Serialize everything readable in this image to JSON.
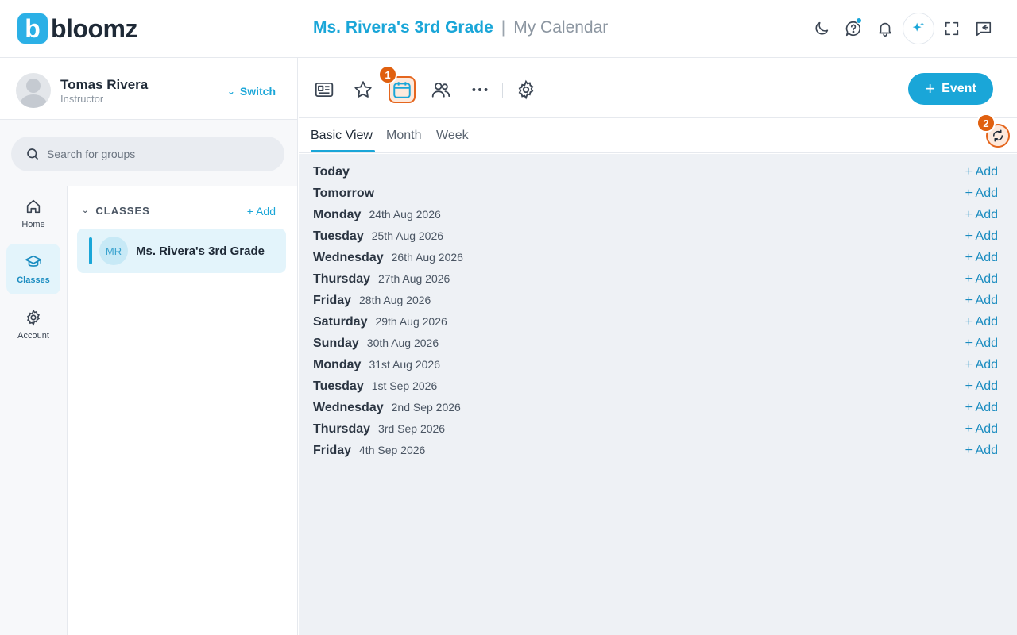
{
  "brand": {
    "name": "bloomz"
  },
  "header": {
    "group_name": "Ms. Rivera's 3rd Grade",
    "separator": "|",
    "page_name": "My Calendar",
    "icons": [
      "moon-icon",
      "help-icon",
      "bell-icon",
      "ai-sparkle-icon",
      "fullscreen-icon",
      "feedback-icon"
    ]
  },
  "profile": {
    "name": "Tomas Rivera",
    "role": "Instructor",
    "switch_label": "Switch"
  },
  "search": {
    "placeholder": "Search for groups"
  },
  "nav": {
    "items": [
      {
        "label": "Home",
        "icon": "home-icon",
        "active": false
      },
      {
        "label": "Classes",
        "icon": "graduation-cap-icon",
        "active": true
      },
      {
        "label": "Account",
        "icon": "gear-icon",
        "active": false
      }
    ]
  },
  "classes": {
    "heading": "CLASSES",
    "add_label": "Add",
    "items": [
      {
        "initials": "MR",
        "name": "Ms. Rivera's 3rd Grade"
      }
    ]
  },
  "toolbar": {
    "icons": [
      "newsletter-icon",
      "star-icon",
      "calendar-icon",
      "people-icon",
      "more-icon",
      "settings-icon"
    ],
    "badge_1": "1",
    "badge_2": "2",
    "event_label": "Event",
    "accent": "#1aa6d8",
    "highlight": "#e5661e"
  },
  "tabs": {
    "items": [
      "Basic View",
      "Month",
      "Week"
    ],
    "active": "Basic View"
  },
  "calendar": {
    "add_label": "+ Add",
    "rows": [
      {
        "day": "Today",
        "date": ""
      },
      {
        "day": "Tomorrow",
        "date": ""
      },
      {
        "day": "Monday",
        "date": "24th Aug 2026"
      },
      {
        "day": "Tuesday",
        "date": "25th Aug 2026"
      },
      {
        "day": "Wednesday",
        "date": "26th Aug 2026"
      },
      {
        "day": "Thursday",
        "date": "27th Aug 2026"
      },
      {
        "day": "Friday",
        "date": "28th Aug 2026"
      },
      {
        "day": "Saturday",
        "date": "29th Aug 2026"
      },
      {
        "day": "Sunday",
        "date": "30th Aug 2026"
      },
      {
        "day": "Monday",
        "date": "31st Aug 2026"
      },
      {
        "day": "Tuesday",
        "date": "1st Sep 2026"
      },
      {
        "day": "Wednesday",
        "date": "2nd Sep 2026"
      },
      {
        "day": "Thursday",
        "date": "3rd Sep 2026"
      },
      {
        "day": "Friday",
        "date": "4th Sep 2026"
      }
    ]
  }
}
